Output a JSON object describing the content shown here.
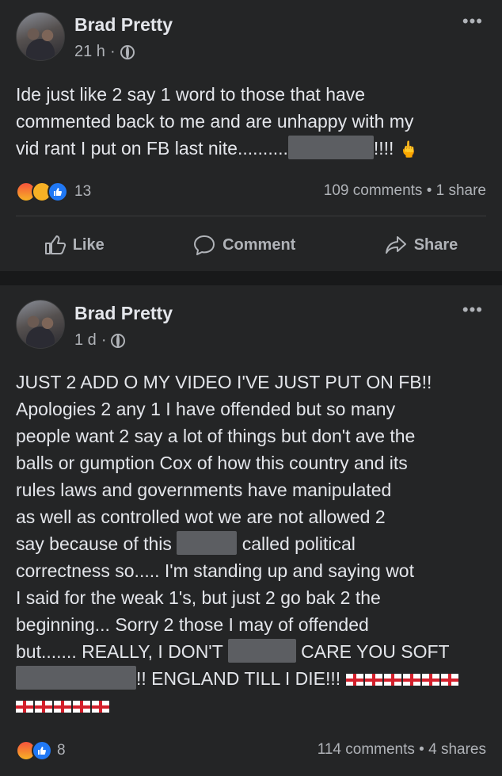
{
  "posts": [
    {
      "author": "Brad Pretty",
      "time": "21 h",
      "dot": "·",
      "more": "•••",
      "line1": "Ide just like 2 say 1 word to those that have",
      "line2": "commented back to me and are unhappy with my",
      "line3a": "vid rant I put on FB last nite..........",
      "line3b": "!!!!",
      "hand_emoji": "🖕",
      "reaction_count": "13",
      "stats": "109 comments • 1 share",
      "actions": {
        "like": "Like",
        "comment": "Comment",
        "share": "Share"
      }
    },
    {
      "author": "Brad Pretty",
      "time": "1 d",
      "dot": "·",
      "more": "•••",
      "lines": [
        "JUST 2 ADD O  MY VIDEO I'VE JUST PUT ON FB!!",
        "Apologies 2 any 1 I have offended but so many",
        "people want 2 say a lot of things but don't ave the",
        "balls or gumption Cox of how this country and its",
        "rules laws and governments have manipulated",
        "as well as controlled wot we are not allowed 2"
      ],
      "line7a": "say because of this",
      "line7b": "called political",
      "lines_b": [
        "correctness so..... I'm standing up and saying wot",
        "I said for the weak 1's, but just 2 go bak 2 the",
        "beginning... Sorry 2 those I may of offended"
      ],
      "line11a": "but....... REALLY, I DON'T",
      "line11b": "CARE YOU SOFT",
      "line12": "!! ENGLAND TILL I DIE!!!",
      "reaction_count": "8",
      "stats": "114 comments • 4 shares"
    }
  ],
  "colors": {
    "bg": "#18191a",
    "card": "#242526",
    "text": "#e4e6eb",
    "muted": "#b0b3b8",
    "like_blue": "#2078f4"
  }
}
